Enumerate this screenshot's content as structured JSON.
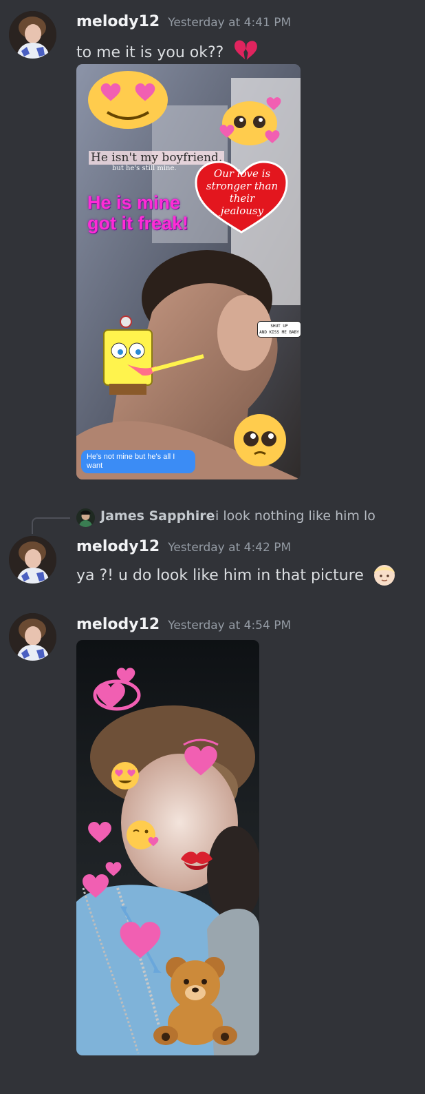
{
  "messages": [
    {
      "username": "melody12",
      "timestamp": "Yesterday at 4:41 PM",
      "text": "to me it is you ok??",
      "text_emoji": "broken-heart",
      "attachment": {
        "stickers": {
          "boyfriend_title": "He isn't my boyfriend.",
          "boyfriend_sub": "but he's still mine.",
          "mine_line1": "He is mine",
          "mine_line2": "got it freak!",
          "love_line1": "Our love is",
          "love_line2": "stronger than",
          "love_line3": "their",
          "love_line4": "jealousy",
          "shut_up_line1": "SHUT UP",
          "shut_up_line2": "AND KISS ME BABY",
          "bubble": "He's not mine but he's all I want"
        }
      }
    },
    {
      "reply": {
        "username": "James Sapphire",
        "text": "i look nothing like him lo"
      },
      "username": "melody12",
      "timestamp": "Yesterday at 4:42 PM",
      "text": "ya ?! u do look like him in that picture",
      "text_emoji": "person-blond"
    },
    {
      "username": "melody12",
      "timestamp": "Yesterday at 4:54 PM",
      "attachment": {
        "emojis": [
          "revolving-hearts",
          "heart-eyes",
          "growing-heart",
          "kissing-heart",
          "kiss-mark",
          "two-hearts",
          "heart-with-arrow",
          "teddy-bear"
        ]
      }
    }
  ],
  "colors": {
    "background": "#313338",
    "username": "#f2f3f5",
    "timestamp": "#949ba4",
    "text": "#dbdee1"
  }
}
